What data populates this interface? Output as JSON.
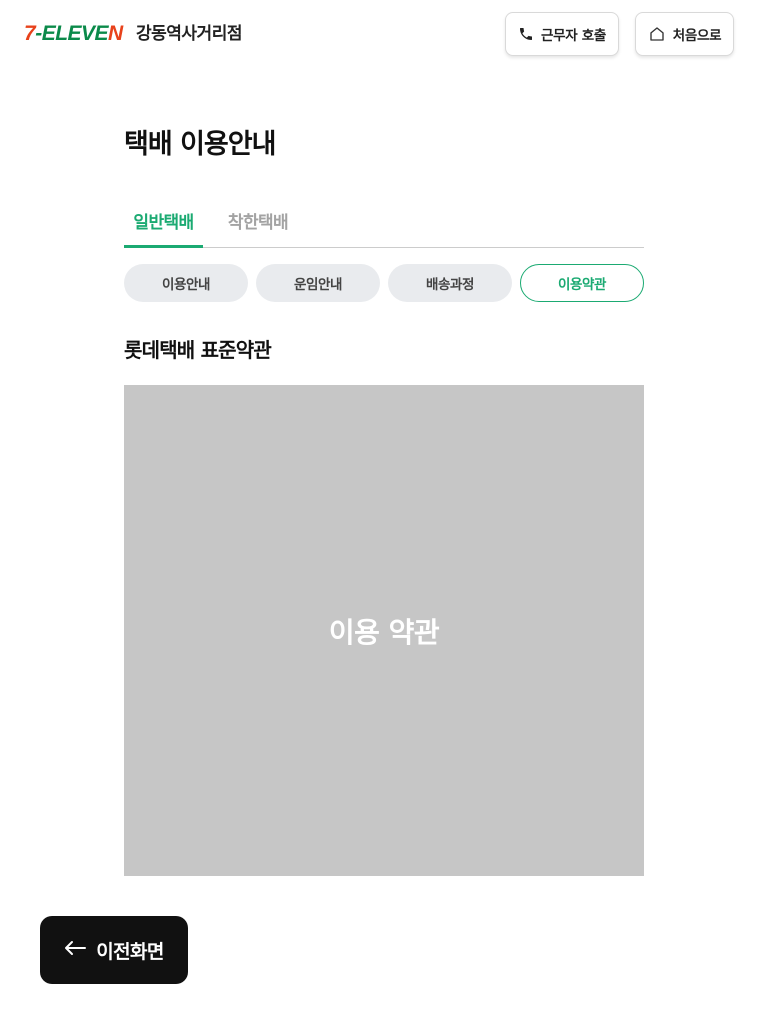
{
  "header": {
    "logo": {
      "seven": "7",
      "dash": "-",
      "eleve": "ELEVE",
      "n": "N"
    },
    "store_name": "강동역사거리점",
    "call_button": {
      "label": "근무자 호출",
      "icon": "phone-icon"
    },
    "home_button": {
      "label": "처음으로",
      "icon": "home-icon"
    }
  },
  "main": {
    "title": "택배 이용안내",
    "tabs": [
      {
        "label": "일반택배",
        "active": true
      },
      {
        "label": "착한택배",
        "active": false
      }
    ],
    "pills": [
      {
        "label": "이용안내",
        "active": false
      },
      {
        "label": "운임안내",
        "active": false
      },
      {
        "label": "배송과정",
        "active": false
      },
      {
        "label": "이용약관",
        "active": true
      }
    ],
    "section_title": "롯데택배 표준약관",
    "terms_placeholder": "이용 약관"
  },
  "footer": {
    "back_button": {
      "label": "이전화면",
      "icon": "arrow-left-icon"
    }
  },
  "colors": {
    "accent": "#1baa72",
    "logo_red": "#e8421b",
    "logo_green": "#0b8a4a",
    "placeholder_bg": "#c6c6c6",
    "back_button_bg": "#111111"
  }
}
